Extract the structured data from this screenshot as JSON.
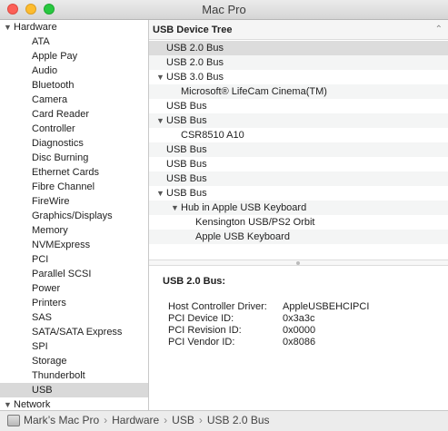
{
  "window": {
    "title": "Mac Pro"
  },
  "sidebar": {
    "groups": [
      {
        "label": "Hardware",
        "expanded": true,
        "items": [
          "ATA",
          "Apple Pay",
          "Audio",
          "Bluetooth",
          "Camera",
          "Card Reader",
          "Controller",
          "Diagnostics",
          "Disc Burning",
          "Ethernet Cards",
          "Fibre Channel",
          "FireWire",
          "Graphics/Displays",
          "Memory",
          "NVMExpress",
          "PCI",
          "Parallel SCSI",
          "Power",
          "Printers",
          "SAS",
          "SATA/SATA Express",
          "SPI",
          "Storage",
          "Thunderbolt",
          "USB"
        ]
      },
      {
        "label": "Network",
        "expanded": true,
        "items": []
      }
    ],
    "selected": "USB"
  },
  "tree": {
    "header": "USB Device Tree",
    "rows": [
      {
        "label": "USB 2.0 Bus",
        "level": 0,
        "expanded": null,
        "selected": true
      },
      {
        "label": "USB 2.0 Bus",
        "level": 0,
        "expanded": null
      },
      {
        "label": "USB 3.0 Bus",
        "level": 0,
        "expanded": true
      },
      {
        "label": "Microsoft® LifeCam Cinema(TM)",
        "level": 1,
        "expanded": null
      },
      {
        "label": "USB Bus",
        "level": 0,
        "expanded": null
      },
      {
        "label": "USB Bus",
        "level": 0,
        "expanded": true
      },
      {
        "label": "CSR8510 A10",
        "level": 1,
        "expanded": null
      },
      {
        "label": "USB Bus",
        "level": 0,
        "expanded": null
      },
      {
        "label": "USB Bus",
        "level": 0,
        "expanded": null
      },
      {
        "label": "USB Bus",
        "level": 0,
        "expanded": null
      },
      {
        "label": "USB Bus",
        "level": 0,
        "expanded": true
      },
      {
        "label": "Hub in Apple USB Keyboard",
        "level": 1,
        "expanded": true
      },
      {
        "label": "Kensington USB/PS2 Orbit",
        "level": 2,
        "expanded": null
      },
      {
        "label": "Apple USB Keyboard",
        "level": 2,
        "expanded": null
      }
    ]
  },
  "detail": {
    "title": "USB 2.0 Bus:",
    "properties": [
      {
        "label": "Host Controller Driver:",
        "value": "AppleUSBEHCIPCI"
      },
      {
        "label": "PCI Device ID:",
        "value": "0x3a3c"
      },
      {
        "label": "PCI Revision ID:",
        "value": "0x0000"
      },
      {
        "label": "PCI Vendor ID:",
        "value": "0x8086"
      }
    ]
  },
  "statusbar": {
    "path": [
      "Mark’s Mac Pro",
      "Hardware",
      "USB",
      "USB 2.0 Bus"
    ]
  }
}
